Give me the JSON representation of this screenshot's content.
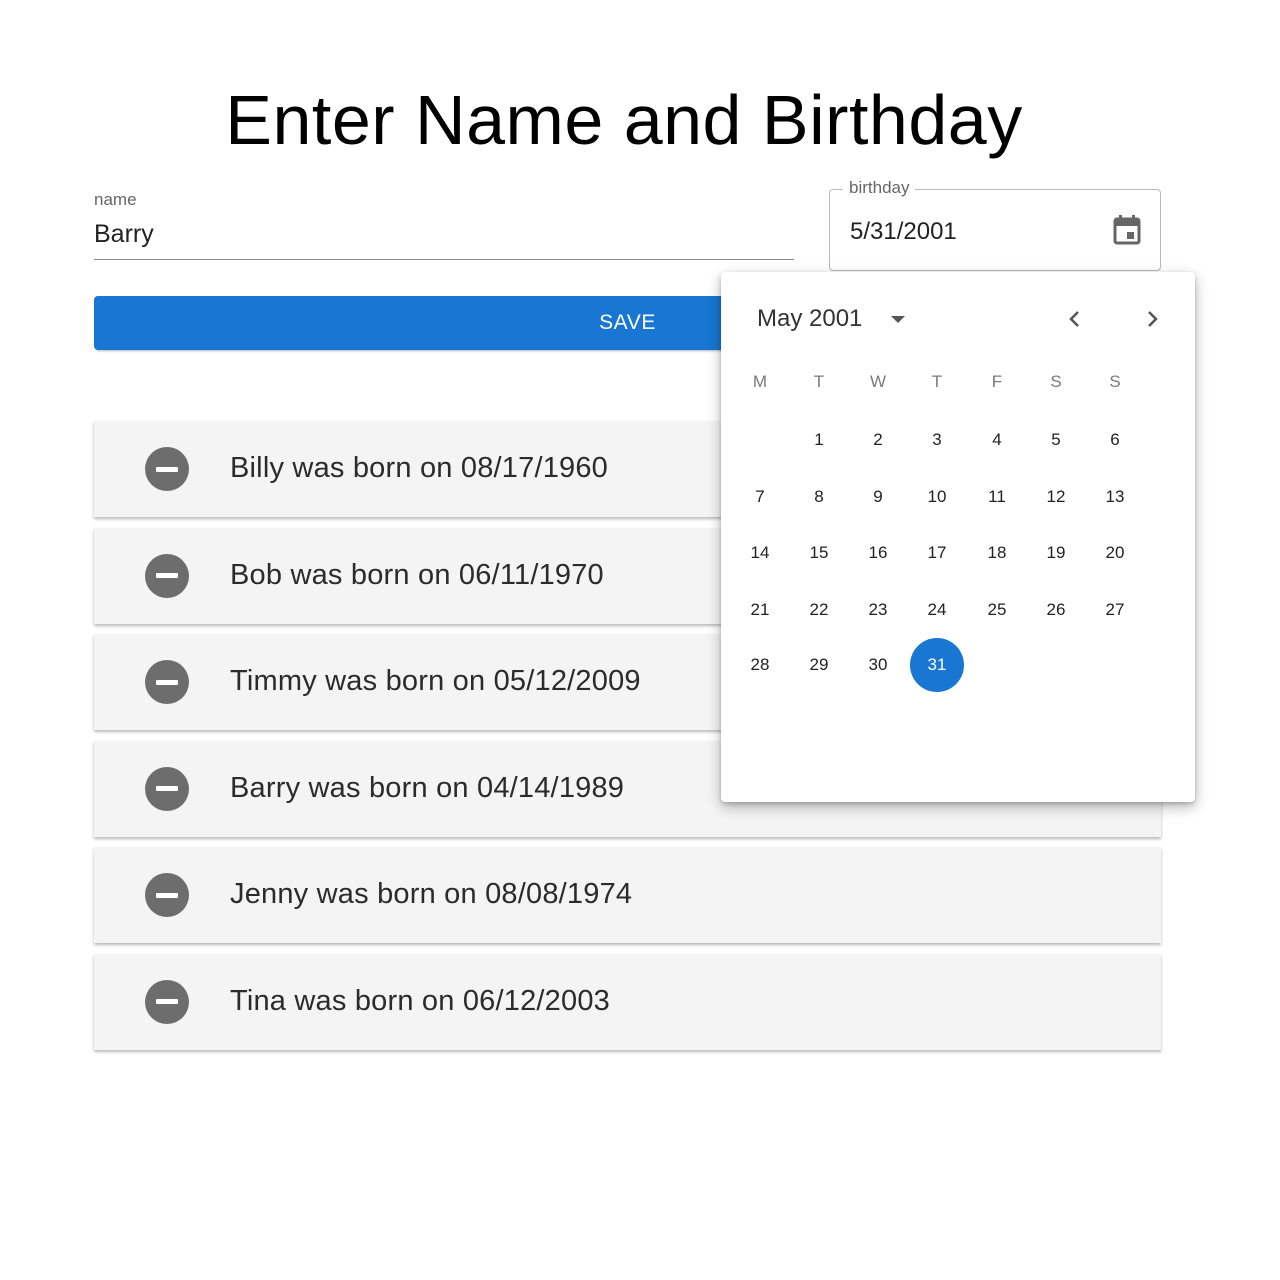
{
  "page": {
    "title": "Enter Name and Birthday"
  },
  "form": {
    "name_label": "name",
    "name_value": "Barry",
    "birthday_label": "birthday",
    "birthday_value": "5/31/2001",
    "save_label": "SAVE"
  },
  "people": [
    {
      "text": "Billy was born on 08/17/1960"
    },
    {
      "text": "Bob was born on 06/11/1970"
    },
    {
      "text": "Timmy was born on 05/12/2009"
    },
    {
      "text": "Barry was born on 04/14/1989"
    },
    {
      "text": "Jenny was born on 08/08/1974"
    },
    {
      "text": "Tina was born on 06/12/2003"
    }
  ],
  "datepicker": {
    "month_label": "May 2001",
    "weekdays": [
      "M",
      "T",
      "W",
      "T",
      "F",
      "S",
      "S"
    ],
    "days": [
      "1",
      "2",
      "3",
      "4",
      "5",
      "6",
      "7",
      "8",
      "9",
      "10",
      "11",
      "12",
      "13",
      "14",
      "15",
      "16",
      "17",
      "18",
      "19",
      "20",
      "21",
      "22",
      "23",
      "24",
      "25",
      "26",
      "27",
      "28",
      "29",
      "30",
      "31"
    ],
    "selected_day": "31",
    "accent_color": "#1976d2"
  },
  "icons": {
    "calendar": "calendar-icon",
    "remove": "remove-circle-icon",
    "prev": "chevron-left-icon",
    "next": "chevron-right-icon",
    "month_dropdown": "caret-down-icon"
  }
}
